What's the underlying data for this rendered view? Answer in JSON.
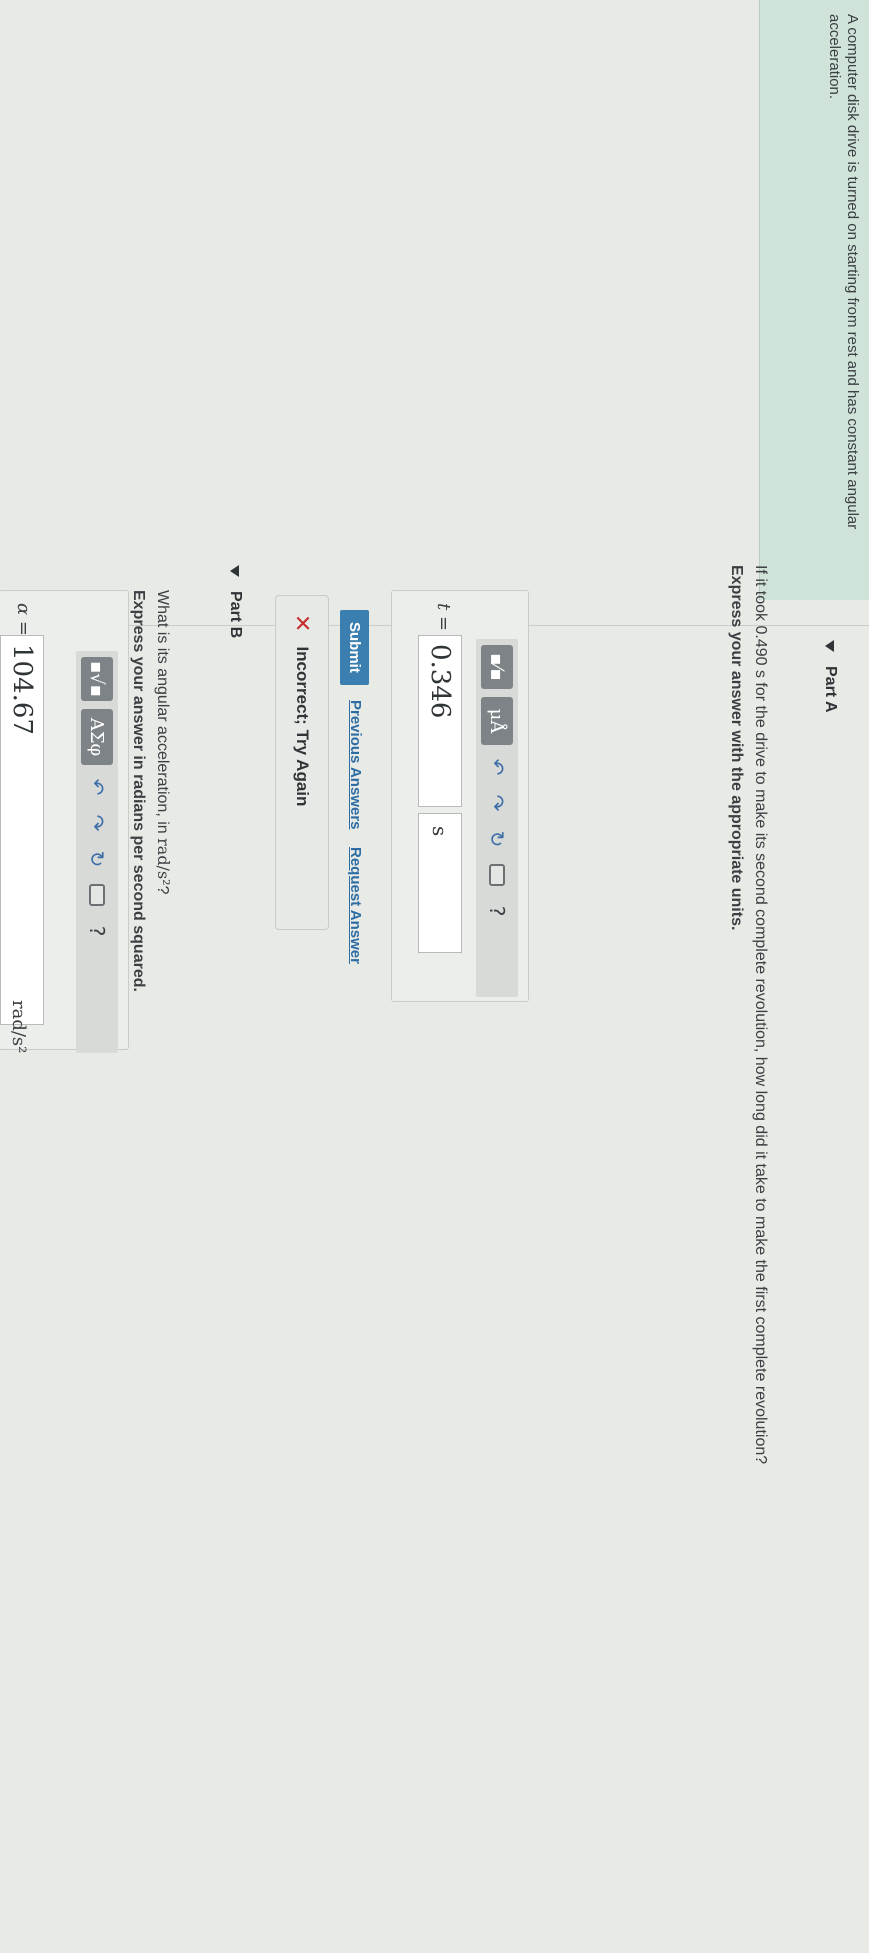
{
  "problem": {
    "text": "A computer disk drive is turned on starting from rest and has constant angular acceleration."
  },
  "part_a": {
    "title": "Part A",
    "question": "If it took 0.490 s for the drive to make its second complete revolution, how long did it take to make the first complete revolution?",
    "instruction": "Express your answer with the appropriate units.",
    "toolbar": {
      "template_label": "▪⁄▪",
      "units_label": "μÅ",
      "undo_icon": "undo-icon",
      "redo_icon": "redo-icon",
      "reset_icon": "reset-icon",
      "keyboard_icon": "keyboard-icon",
      "help_label": "?"
    },
    "variable_label": "t =",
    "value": "0.346",
    "unit": "s",
    "submit_label": "Submit",
    "previous_answers_label": "Previous Answers",
    "request_answer_label": "Request Answer",
    "feedback_icon": "x-mark-icon",
    "feedback_text": "Incorrect; Try Again"
  },
  "part_b": {
    "title": "Part B",
    "question_prefix": "What is its angular acceleration, in ",
    "question_unit": "rad/s²",
    "question_suffix": "?",
    "instruction": "Express your answer in radians per second squared.",
    "toolbar": {
      "template_label": "▪√▪",
      "greek_label": "ΑΣφ",
      "help_label": "?"
    },
    "variable_label": "α =",
    "value": "104.67",
    "unit": "rad/s²"
  },
  "colors": {
    "problem_bg": "#cfe3d9",
    "submit_bg": "#3a7fb0",
    "link": "#2e6da4",
    "error": "#c4302b"
  }
}
